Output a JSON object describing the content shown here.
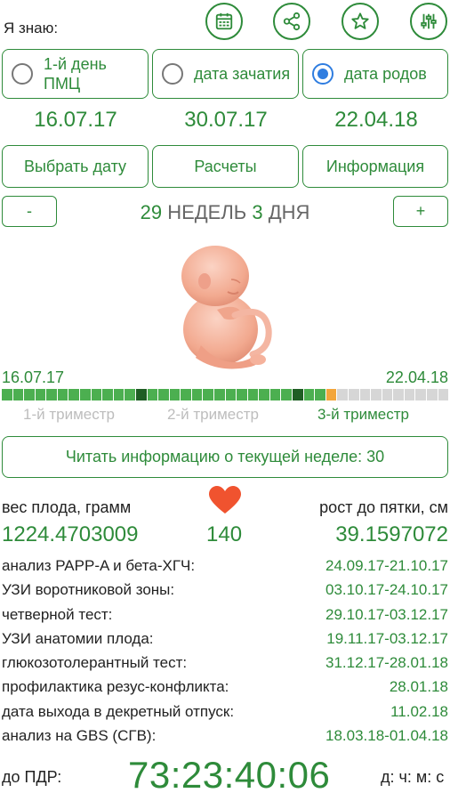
{
  "header": {
    "know_label": "Я знаю:",
    "icons": [
      "calendar-icon",
      "share-icon",
      "star-icon",
      "settings-sliders-icon"
    ]
  },
  "options": [
    {
      "label": "1-й день ПМЦ",
      "selected": false,
      "date": "16.07.17"
    },
    {
      "label": "дата зачатия",
      "selected": false,
      "date": "30.07.17"
    },
    {
      "label": "дата родов",
      "selected": true,
      "date": "22.04.18"
    }
  ],
  "actions": {
    "pick_date": "Выбрать дату",
    "calculations": "Расчеты",
    "information": "Информация"
  },
  "stepper": {
    "minus": "-",
    "plus": "+",
    "weeks_num": "29",
    "weeks_word": "НЕДЕЛЬ",
    "days_num": "3",
    "days_word": "ДНЯ"
  },
  "timeline": {
    "start_date": "16.07.17",
    "end_date": "22.04.18",
    "total_weeks": 40,
    "passed_weeks": 29,
    "trimester_marks": [
      13,
      27
    ],
    "colors": {
      "passed": "#4caf50",
      "current": "#f3a63b",
      "future": "#d6d6d6",
      "mark": "#1f5e24"
    },
    "trimesters": [
      "1-й триместр",
      "2-й триместр",
      "3-й триместр"
    ],
    "active_trimester": 2
  },
  "read_button": "Читать информацию о текущей неделе: 30",
  "metrics": {
    "weight_label": "вес плода, грамм",
    "weight_value": "1224.4703009",
    "heart_rate": "140",
    "height_label": "рост до пятки, см",
    "height_value": "39.1597072"
  },
  "tests": [
    {
      "name": "анализ PAPP-A и бета-ХГЧ:",
      "range": "24.09.17-21.10.17"
    },
    {
      "name": "УЗИ воротниковой зоны:",
      "range": "03.10.17-24.10.17"
    },
    {
      "name": "четверной тест:",
      "range": "29.10.17-03.12.17"
    },
    {
      "name": "УЗИ анатомии плода:",
      "range": "19.11.17-03.12.17"
    },
    {
      "name": "глюкозотолерантный тест:",
      "range": "31.12.17-28.01.18"
    },
    {
      "name": "профилактика резус-конфликта:",
      "range": "28.01.18"
    },
    {
      "name": "дата выхода в декретный отпуск:",
      "range": "11.02.18"
    },
    {
      "name": "анализ на GBS (СГВ):",
      "range": "18.03.18-01.04.18"
    }
  ],
  "countdown": {
    "label": "до ПДР:",
    "value": "73:23:40:06",
    "units": "д: ч: м: с"
  },
  "colors": {
    "accent": "#2e8b3a",
    "heart": "#f0532f",
    "radio_selected": "#2f7de0"
  }
}
